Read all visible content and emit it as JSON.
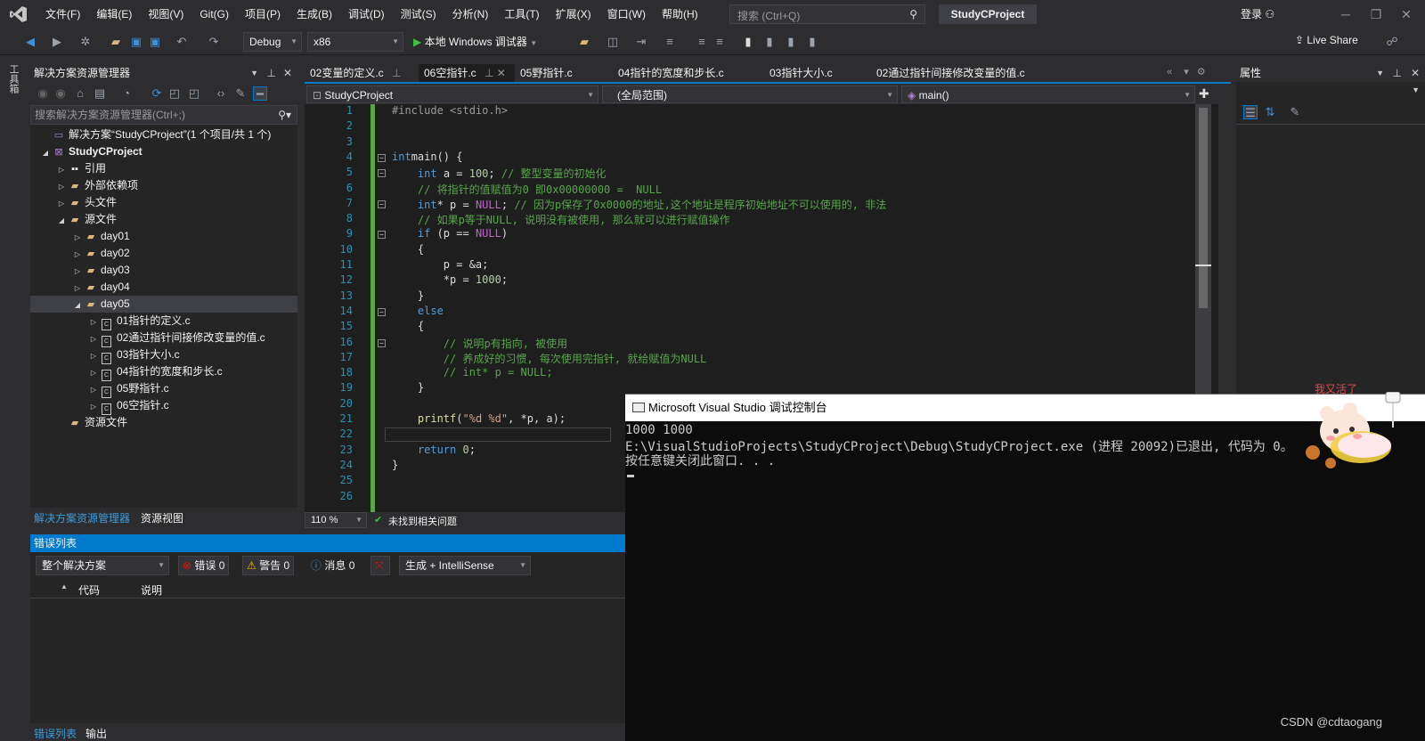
{
  "menu": [
    "文件(F)",
    "编辑(E)",
    "视图(V)",
    "Git(G)",
    "项目(P)",
    "生成(B)",
    "调试(D)",
    "测试(S)",
    "分析(N)",
    "工具(T)",
    "扩展(X)",
    "窗口(W)",
    "帮助(H)"
  ],
  "search": {
    "placeholder": "搜索 (Ctrl+Q)"
  },
  "project_title": "StudyCProject",
  "login": "登录",
  "toolbar": {
    "config": "Debug",
    "platform": "x86",
    "run_label": "本地 Windows 调试器",
    "live_share": "Live Share"
  },
  "left_strip": "工具箱",
  "solution_explorer": {
    "title": "解决方案资源管理器",
    "search_placeholder": "搜索解决方案资源管理器(Ctrl+;)",
    "tree": [
      {
        "label": "解决方案“StudyCProject”(1 个项目/共 1 个)",
        "depth": 0,
        "icon": "solution-icon",
        "tri": ""
      },
      {
        "label": "StudyCProject",
        "depth": 0,
        "icon": "project-icon",
        "tri": "◢",
        "bold": true
      },
      {
        "label": "引用",
        "depth": 1,
        "icon": "references-icon",
        "tri": "▷"
      },
      {
        "label": "外部依赖项",
        "depth": 1,
        "icon": "folder-icon",
        "tri": "▷"
      },
      {
        "label": "头文件",
        "depth": 1,
        "icon": "folder-icon",
        "tri": "▷"
      },
      {
        "label": "源文件",
        "depth": 1,
        "icon": "folder-icon",
        "tri": "◢"
      },
      {
        "label": "day01",
        "depth": 2,
        "icon": "folder-icon",
        "tri": "▷"
      },
      {
        "label": "day02",
        "depth": 2,
        "icon": "folder-icon",
        "tri": "▷"
      },
      {
        "label": "day03",
        "depth": 2,
        "icon": "folder-icon",
        "tri": "▷"
      },
      {
        "label": "day04",
        "depth": 2,
        "icon": "folder-icon",
        "tri": "▷"
      },
      {
        "label": "day05",
        "depth": 2,
        "icon": "folder-icon",
        "tri": "◢",
        "selected": true
      },
      {
        "label": "01指针的定义.c",
        "depth": 3,
        "icon": "c-file-icon",
        "tri": "▷"
      },
      {
        "label": "02通过指针间接修改变量的值.c",
        "depth": 3,
        "icon": "c-file-icon",
        "tri": "▷"
      },
      {
        "label": "03指针大小.c",
        "depth": 3,
        "icon": "c-file-icon",
        "tri": "▷"
      },
      {
        "label": "04指针的宽度和步长.c",
        "depth": 3,
        "icon": "c-file-icon",
        "tri": "▷"
      },
      {
        "label": "05野指针.c",
        "depth": 3,
        "icon": "c-file-icon",
        "tri": "▷"
      },
      {
        "label": "06空指针.c",
        "depth": 3,
        "icon": "c-file-icon",
        "tri": "▷"
      },
      {
        "label": "资源文件",
        "depth": 1,
        "icon": "folder-icon",
        "tri": ""
      }
    ],
    "bottom_tabs": [
      "解决方案资源管理器",
      "资源视图"
    ]
  },
  "editor": {
    "tabs": [
      "02变量的定义.c",
      "06空指针.c",
      "05野指针.c",
      "04指针的宽度和步长.c",
      "03指针大小.c",
      "02通过指针间接修改变量的值.c"
    ],
    "active_tab": 1,
    "nav_project": "StudyCProject",
    "nav_scope": "(全局范围)",
    "nav_func": "main()",
    "zoom": "110 %",
    "issues": "未找到相关问题",
    "lines": [
      [
        [
          "pp",
          "#include <stdio.h>"
        ]
      ],
      [],
      [],
      [
        [
          "ty",
          "int"
        ],
        [
          "",
          "main() {"
        ]
      ],
      [
        [
          "",
          "    "
        ],
        [
          "ty",
          "int"
        ],
        [
          "",
          " a = "
        ],
        [
          "nm",
          "100"
        ],
        [
          "",
          ";"
        ],
        [
          "cm",
          " // 整型变量的初始化"
        ]
      ],
      [
        [
          "cm",
          "    // 将指针的值赋值为0 即0x00000000 =  NULL"
        ]
      ],
      [
        [
          "",
          "    "
        ],
        [
          "ty",
          "int"
        ],
        [
          "",
          "* p = "
        ],
        [
          "mc",
          "NULL"
        ],
        [
          "",
          ";"
        ],
        [
          "cm",
          " // 因为p保存了0x0000的地址,这个地址是程序初始地址不可以使用的, 非法"
        ]
      ],
      [
        [
          "cm",
          "    // 如果p等于NULL, 说明没有被使用, 那么就可以进行赋值操作"
        ]
      ],
      [
        [
          "",
          "    "
        ],
        [
          "kw",
          "if"
        ],
        [
          "",
          " (p == "
        ],
        [
          "mc",
          "NULL"
        ],
        [
          "",
          ")"
        ]
      ],
      [
        [
          "",
          "    {"
        ]
      ],
      [
        [
          "",
          "        p = &a;"
        ]
      ],
      [
        [
          "",
          "        *p = "
        ],
        [
          "nm",
          "1000"
        ],
        [
          "",
          ";"
        ]
      ],
      [
        [
          "",
          "    }"
        ]
      ],
      [
        [
          "",
          "    "
        ],
        [
          "kw",
          "else"
        ]
      ],
      [
        [
          "",
          "    {"
        ]
      ],
      [
        [
          "cm",
          "        // 说明p有指向, 被使用"
        ]
      ],
      [
        [
          "cm",
          "        // 养成好的习惯, 每次使用完指针, 就给赋值为NULL"
        ]
      ],
      [
        [
          "cm",
          "        // int* p = NULL;"
        ]
      ],
      [
        [
          "",
          "    }"
        ]
      ],
      [],
      [
        [
          "",
          "    "
        ],
        [
          "fn",
          "printf"
        ],
        [
          "",
          "("
        ],
        [
          "st",
          "\"%d %d\""
        ],
        [
          "",
          ", *p, a);"
        ]
      ],
      [],
      [
        [
          "",
          "    "
        ],
        [
          "kw",
          "return"
        ],
        [
          "",
          " "
        ],
        [
          "nm",
          "0"
        ],
        [
          "",
          ";"
        ]
      ],
      [
        [
          "",
          "}"
        ]
      ],
      [],
      []
    ]
  },
  "properties": {
    "title": "属性"
  },
  "error_list": {
    "title": "错误列表",
    "scope": "整个解决方案",
    "errors": "错误 0",
    "warnings": "警告 0",
    "messages": "消息 0",
    "build_filter": "生成 + IntelliSense",
    "col_code": "代码",
    "col_desc": "说明",
    "bottom_tabs": [
      "错误列表",
      "输出"
    ]
  },
  "console": {
    "title": "Microsoft Visual Studio 调试控制台",
    "lines": [
      "1000 1000",
      "E:\\VisualStudioProjects\\StudyCProject\\Debug\\StudyCProject.exe (进程 20092)已退出, 代码为 0。",
      "按任意键关闭此窗口. . ."
    ]
  },
  "sticker_text": "我又活了",
  "watermark": "CSDN @cdtaogang"
}
